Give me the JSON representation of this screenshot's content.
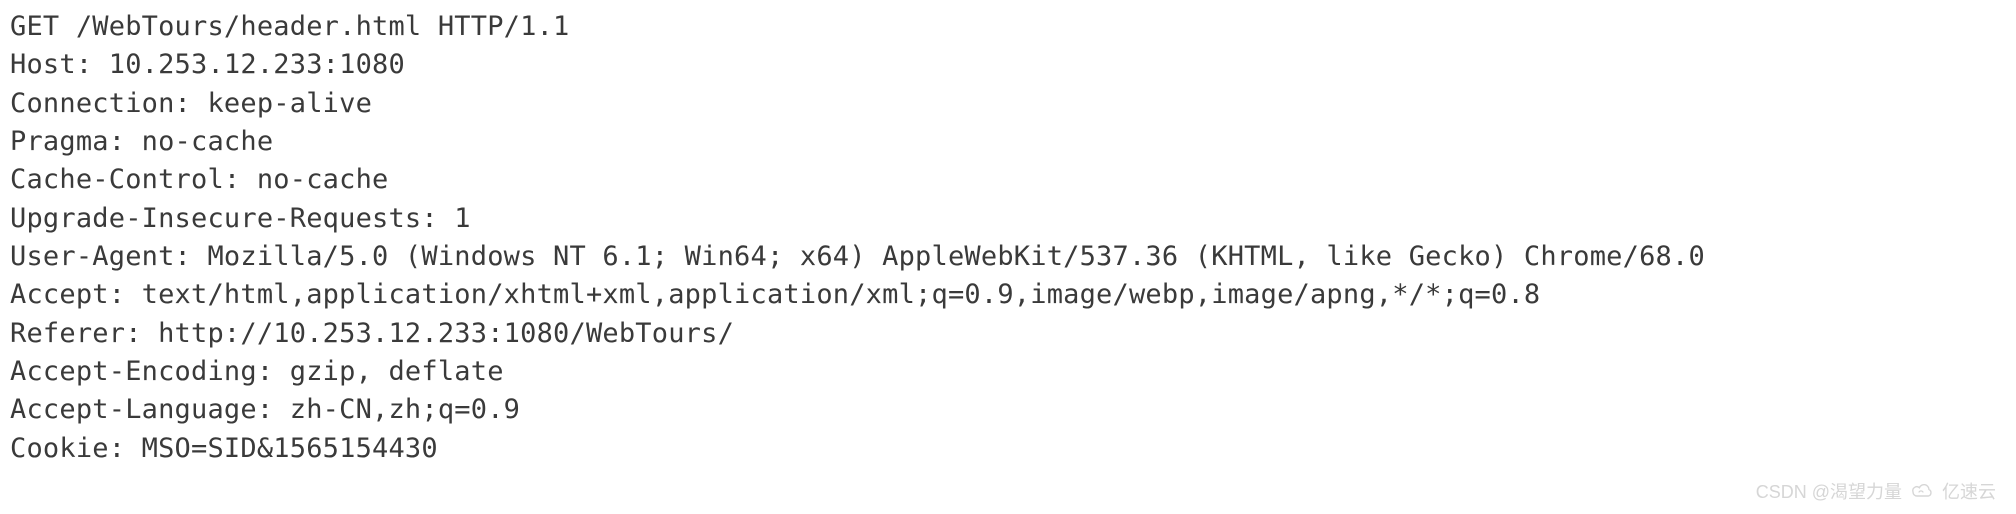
{
  "http": {
    "request_line": "GET /WebTours/header.html HTTP/1.1",
    "headers": [
      "Host: 10.253.12.233:1080",
      "Connection: keep-alive",
      "Pragma: no-cache",
      "Cache-Control: no-cache",
      "Upgrade-Insecure-Requests: 1",
      "User-Agent: Mozilla/5.0 (Windows NT 6.1; Win64; x64) AppleWebKit/537.36 (KHTML, like Gecko) Chrome/68.0",
      "Accept: text/html,application/xhtml+xml,application/xml;q=0.9,image/webp,image/apng,*/*;q=0.8",
      "Referer: http://10.253.12.233:1080/WebTours/",
      "Accept-Encoding: gzip, deflate",
      "Accept-Language: zh-CN,zh;q=0.9",
      "Cookie: MSO=SID&1565154430"
    ]
  },
  "watermark": {
    "text_left": "CSDN @渴望力量",
    "text_right": "亿速云"
  }
}
